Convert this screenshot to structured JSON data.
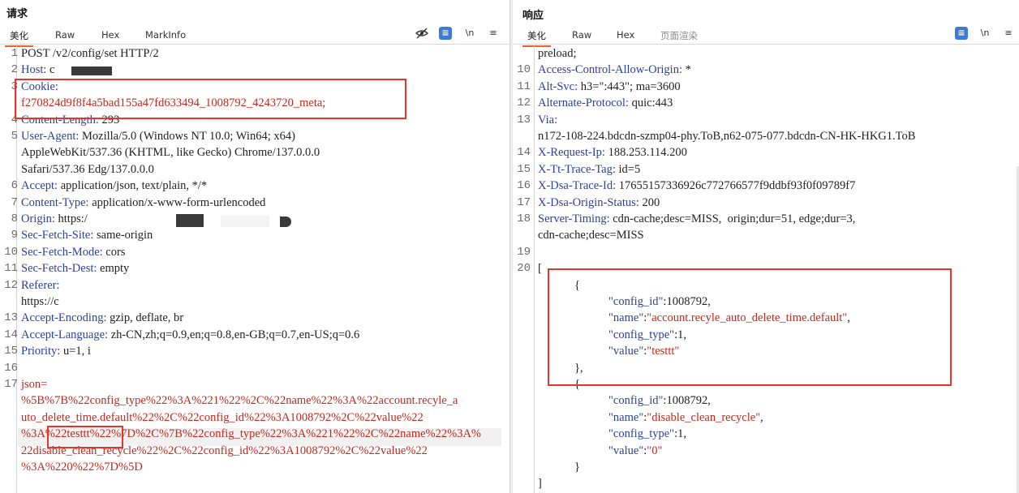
{
  "request": {
    "title": "请求",
    "tabs": [
      "美化",
      "Raw",
      "Hex",
      "MarkInfo"
    ],
    "tools": [
      "hide-icon",
      "wrap-icon",
      "newline-icon",
      "menu-icon"
    ],
    "tool_newline_label": "\\n",
    "lines": [
      {
        "n": "1",
        "t": "POST /v2/config/set HTTP/2"
      },
      {
        "n": "2",
        "k": "Host:",
        "v": " c"
      },
      {
        "n": "3",
        "k": "Cookie:",
        "v": ""
      },
      {
        "n": "",
        "v": "f270824d9f8f4a5bad155a47fd633494_1008792_4243720_meta;"
      },
      {
        "n": "4",
        "k": "Content-Length:",
        "v": " 293"
      },
      {
        "n": "5",
        "k": "User-Agent:",
        "v": " Mozilla/5.0 (Windows NT 10.0; Win64; x64)"
      },
      {
        "n": "",
        "v": "AppleWebKit/537.36 (KHTML, like Gecko) Chrome/137.0.0.0"
      },
      {
        "n": "",
        "v": "Safari/537.36 Edg/137.0.0.0"
      },
      {
        "n": "6",
        "k": "Accept:",
        "v": " application/json, text/plain, */*"
      },
      {
        "n": "7",
        "k": "Content-Type:",
        "v": " application/x-www-form-urlencoded"
      },
      {
        "n": "8",
        "k": "Origin:",
        "v": " https:/"
      },
      {
        "n": "9",
        "k": "Sec-Fetch-Site:",
        "v": " same-origin"
      },
      {
        "n": "10",
        "k": "Sec-Fetch-Mode:",
        "v": " cors"
      },
      {
        "n": "11",
        "k": "Sec-Fetch-Dest:",
        "v": " empty"
      },
      {
        "n": "12",
        "k": "Referer:",
        "v": ""
      },
      {
        "n": "",
        "v": "https://c"
      },
      {
        "n": "13",
        "k": "Accept-Encoding:",
        "v": " gzip, deflate, br"
      },
      {
        "n": "14",
        "k": "Accept-Language:",
        "v": " zh-CN,zh;q=0.9,en;q=0.8,en-GB;q=0.7,en-US;q=0.6"
      },
      {
        "n": "15",
        "k": "Priority:",
        "v": " u=1, i"
      },
      {
        "n": "16",
        "v": ""
      },
      {
        "n": "17",
        "body": "json="
      },
      {
        "n": "",
        "body": "%5B%7B%22config_type%22%3A%221%22%2C%22name%22%3A%22account.recyle_a"
      },
      {
        "n": "",
        "body": "uto_delete_time.default%22%2C%22config_id%22%3A1008792%2C%22value%22"
      },
      {
        "n": "",
        "body": "%3A%22testtt%22%7D%2C%7B%22config_type%22%3A%221%22%2C%22name%22%3A%"
      },
      {
        "n": "",
        "body": "22disable_clean_recycle%22%2C%22config_id%22%3A1008792%2C%22value%22"
      },
      {
        "n": "",
        "body": "%3A%220%22%7D%5D"
      }
    ]
  },
  "response": {
    "title": "响应",
    "tabs": [
      "美化",
      "Raw",
      "Hex",
      "页面渲染"
    ],
    "tools": [
      "wrap-icon",
      "newline-icon",
      "menu-icon"
    ],
    "tool_newline_label": "\\n",
    "lines": [
      {
        "n": "",
        "v": "preload;"
      },
      {
        "n": "10",
        "k": "Access-Control-Allow-Origin:",
        "v": " *"
      },
      {
        "n": "11",
        "k": "Alt-Svc:",
        "v": " h3=\":443\"; ma=3600"
      },
      {
        "n": "12",
        "k": "Alternate-Protocol:",
        "v": " quic:443"
      },
      {
        "n": "13",
        "k": "Via:",
        "v": ""
      },
      {
        "n": "",
        "v": "n172-108-224.bdcdn-szmp04-phy.ToB,n62-075-077.bdcdn-CN-HK-HKG1.ToB"
      },
      {
        "n": "14",
        "k": "X-Request-Ip:",
        "v": " 188.253.114.200"
      },
      {
        "n": "15",
        "k": "X-Tt-Trace-Tag:",
        "v": " id=5"
      },
      {
        "n": "16",
        "k": "X-Dsa-Trace-Id:",
        "v": " 17655157336926c772766577f9ddbf93f0f09789f7"
      },
      {
        "n": "17",
        "k": "X-Dsa-Origin-Status:",
        "v": " 200"
      },
      {
        "n": "18",
        "k": "Server-Timing:",
        "v": " cdn-cache;desc=MISS,  origin;dur=51, edge;dur=3,"
      },
      {
        "n": "",
        "v": "cdn-cache;desc=MISS"
      },
      {
        "n": "19",
        "v": ""
      },
      {
        "n": "20",
        "v": "["
      }
    ],
    "json": [
      {
        "indent": 1,
        "t": "{"
      },
      {
        "indent": 2,
        "key": "\"config_id\"",
        "sep": ":",
        "num": "1008792",
        "end": ","
      },
      {
        "indent": 2,
        "key": "\"name\"",
        "sep": ":",
        "str": "\"account.recyle_auto_delete_time.default\"",
        "end": ","
      },
      {
        "indent": 2,
        "key": "\"config_type\"",
        "sep": ":",
        "num": "1",
        "end": ","
      },
      {
        "indent": 2,
        "key": "\"value\"",
        "sep": ":",
        "str": "\"testtt\"",
        "end": ""
      },
      {
        "indent": 1,
        "t": "},"
      },
      {
        "indent": 1,
        "t": "{"
      },
      {
        "indent": 2,
        "key": "\"config_id\"",
        "sep": ":",
        "num": "1008792",
        "end": ","
      },
      {
        "indent": 2,
        "key": "\"name\"",
        "sep": ":",
        "str": "\"disable_clean_recycle\"",
        "end": ","
      },
      {
        "indent": 2,
        "key": "\"config_type\"",
        "sep": ":",
        "num": "1",
        "end": ","
      },
      {
        "indent": 2,
        "key": "\"value\"",
        "sep": ":",
        "str": "\"0\"",
        "end": ""
      },
      {
        "indent": 1,
        "t": "}"
      },
      {
        "indent": 0,
        "t": "]"
      }
    ]
  },
  "colors": {
    "key": "#2c3fa0",
    "body": "#c0291e",
    "highlight_box": "#e3372b",
    "accent_tab": "#e8622c",
    "tool_blue": "#3d7bd9"
  }
}
